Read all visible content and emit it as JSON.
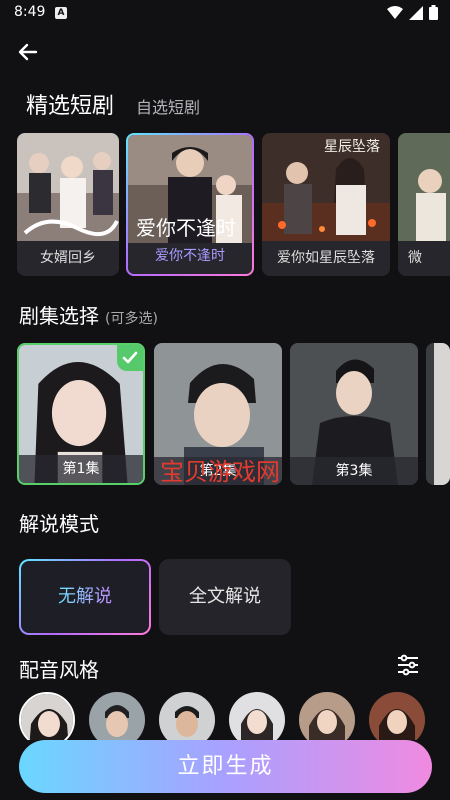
{
  "status_bar": {
    "time": "8:49",
    "notif_letter": "A"
  },
  "tabs": {
    "active": "精选短剧",
    "inactive": "自选短剧"
  },
  "dramas": [
    {
      "title": "女婿回乡",
      "poster_text": "",
      "selected": false
    },
    {
      "title": "爱你不逢时",
      "poster_text": "爱你不逢时",
      "selected": true
    },
    {
      "title": "爱你如星辰坠落",
      "poster_text": "星辰坠落",
      "selected": false
    },
    {
      "title": "微",
      "poster_text": "",
      "selected": false
    }
  ],
  "episodes_section": {
    "title": "剧集选择",
    "hint": "(可多选)"
  },
  "episodes": [
    {
      "label": "第1集",
      "selected": true
    },
    {
      "label": "第2集",
      "selected": false
    },
    {
      "label": "第3集",
      "selected": false
    }
  ],
  "watermark": "宝贝游戏网",
  "mode_section": {
    "title": "解说模式"
  },
  "modes": [
    {
      "label": "无解说",
      "active": true
    },
    {
      "label": "全文解说",
      "active": false
    }
  ],
  "voice_section": {
    "title": "配音风格"
  },
  "generate_button": "立即生成",
  "colors": {
    "accent_start": "#6ad7ff",
    "accent_mid": "#a9a0ff",
    "accent_end": "#f08ae0",
    "check_green": "#56c96a",
    "background": "#111114"
  }
}
